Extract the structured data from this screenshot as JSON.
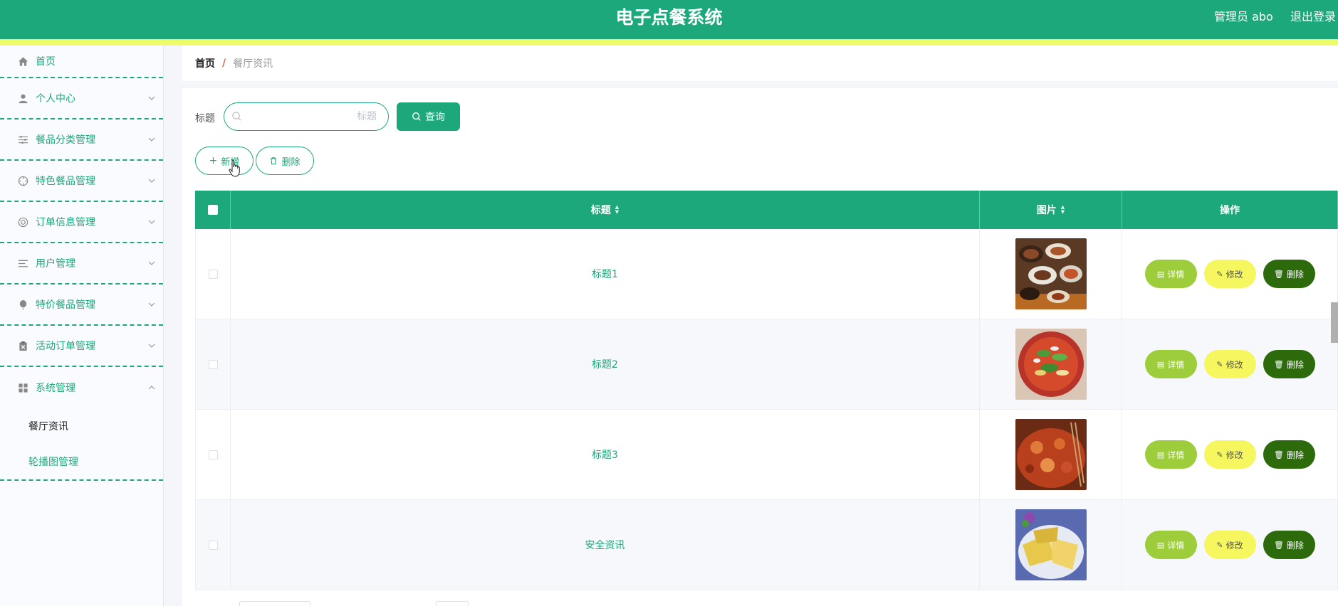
{
  "header": {
    "app_title": "电子点餐系统",
    "admin": "管理员 abo",
    "logout": "退出登录",
    "colors": {
      "primary": "#1ca87a",
      "stripe": "#eefb6a"
    }
  },
  "sidebar": {
    "items": [
      {
        "label": "首页",
        "icon": "home-icon"
      },
      {
        "label": "个人中心",
        "icon": "user-icon"
      },
      {
        "label": "餐品分类管理",
        "icon": "sliders-icon"
      },
      {
        "label": "特色餐品管理",
        "icon": "target-icon"
      },
      {
        "label": "订单信息管理",
        "icon": "lifebuoy-icon"
      },
      {
        "label": "用户管理",
        "icon": "list-icon"
      },
      {
        "label": "特价餐品管理",
        "icon": "balloon-icon"
      },
      {
        "label": "活动订单管理",
        "icon": "clipboard-icon"
      },
      {
        "label": "系统管理",
        "icon": "grid-icon"
      }
    ],
    "submenu": [
      {
        "label": "餐厅资讯"
      },
      {
        "label": "轮播图管理"
      }
    ]
  },
  "breadcrumb": {
    "home": "首页",
    "separator": "/",
    "current": "餐厅资讯"
  },
  "search": {
    "label": "标题",
    "placeholder": "标题",
    "value": "",
    "query_label": "查询"
  },
  "toolbar": {
    "add_label": "新增",
    "delete_label": "删除"
  },
  "table": {
    "headers": {
      "title": "标题",
      "image": "图片",
      "ops": "操作"
    },
    "rows": [
      {
        "title": "标题1",
        "image": "food-photo-dishes"
      },
      {
        "title": "标题2",
        "image": "food-photo-salad-bowl"
      },
      {
        "title": "标题3",
        "image": "food-photo-spicy-pot"
      },
      {
        "title": "安全资讯",
        "image": "food-photo-corn-dish"
      }
    ],
    "op_labels": {
      "detail": "详情",
      "edit": "修改",
      "delete": "删除"
    }
  }
}
